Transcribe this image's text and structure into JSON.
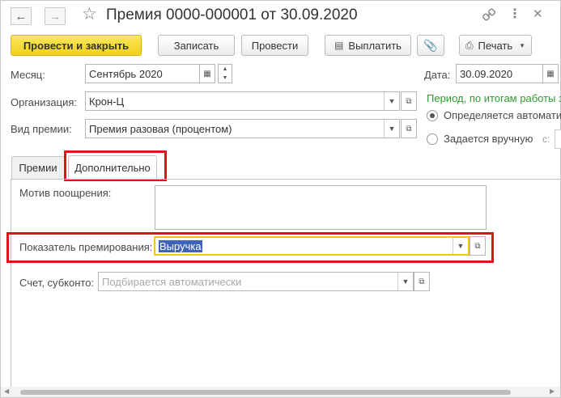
{
  "window": {
    "title": "Премия 0000-000001 от 30.09.2020"
  },
  "toolbar": {
    "post_close": "Провести и закрыть",
    "save": "Записать",
    "post": "Провести",
    "pay": "Выплатить",
    "print": "Печать"
  },
  "form": {
    "month_label": "Месяц:",
    "month_value": "Сентябрь 2020",
    "date_label": "Дата:",
    "date_value": "30.09.2020",
    "org_label": "Организация:",
    "org_value": "Крон-Ц",
    "bonus_type_label": "Вид премии:",
    "bonus_type_value": "Премия разовая (процентом)",
    "period_text": "Период, по итогам работы з",
    "radio_auto": "Определяется автомати",
    "radio_manual": "Задается вручную",
    "from_label": "с:"
  },
  "tabs": [
    {
      "label": "Премии"
    },
    {
      "label": "Дополнительно"
    }
  ],
  "additional": {
    "motive_label": "Мотив поощрения:",
    "indicator_label": "Показатель премирования:",
    "indicator_value": "Выручка",
    "account_label": "Счет, субконто:",
    "account_placeholder": "Подбирается автоматически"
  },
  "colors": {
    "primary_button": "#f1d11b",
    "highlight_border": "#e0131b",
    "selection": "#3e63b8",
    "green_text": "#2f9a2f"
  },
  "icons": [
    "back-arrow",
    "forward-arrow",
    "star",
    "link",
    "more",
    "close",
    "paperclip",
    "printer",
    "calendar",
    "dropdown",
    "open-form"
  ]
}
